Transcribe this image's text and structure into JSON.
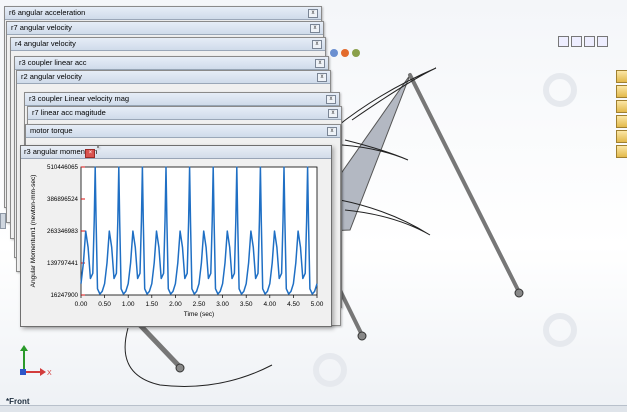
{
  "windows": [
    {
      "title": "r6 angular acceleration"
    },
    {
      "title": "r7 angular velocity"
    },
    {
      "title": "r4 angular velocity"
    },
    {
      "title": "r3 coupler linear acc"
    },
    {
      "title": "r2 angular velocity"
    },
    {
      "title": "r3 coupler Linear velocity mag"
    },
    {
      "title": "r7 linear acc magitude"
    },
    {
      "title": "motor torque"
    }
  ],
  "front_window": {
    "title": "r3 angular momentum",
    "close_glyph": "×"
  },
  "close_glyph": "x",
  "view_label": "*Front",
  "triad": {
    "x_label": "X",
    "y_label": "Y"
  },
  "colors": {
    "series": "#1f6fc4",
    "plot_bg": "#ffffff",
    "axis": "#000000"
  },
  "chart_data": {
    "type": "line",
    "xlabel": "Time (sec)",
    "ylabel": "Angular Momentum1 (newton-mm-sec)",
    "xlim": [
      0.0,
      5.0
    ],
    "ylim": [
      16247900,
      510446065
    ],
    "x_ticks": [
      "0.00",
      "0.50",
      "1.00",
      "1.50",
      "2.00",
      "2.50",
      "3.00",
      "3.50",
      "4.00",
      "4.50",
      "5.00"
    ],
    "y_ticks": [
      "16247900",
      "139797441",
      "263346983",
      "386896524",
      "510446065"
    ],
    "grid": false,
    "series": [
      {
        "period_sec": 0.5,
        "x": [
          0.0,
          0.05,
          0.1,
          0.15,
          0.2,
          0.25,
          0.28,
          0.3,
          0.32,
          0.35,
          0.4,
          0.45,
          0.5
        ],
        "y": [
          60000000,
          140000000,
          263000000,
          200000000,
          80000000,
          100000000,
          300000000,
          510000000,
          300000000,
          40000000,
          20000000,
          30000000,
          60000000
        ]
      }
    ]
  }
}
